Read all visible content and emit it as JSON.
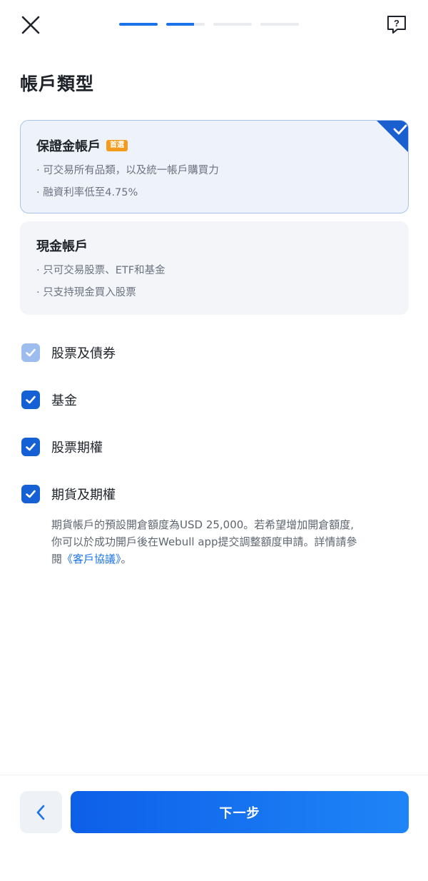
{
  "header": {
    "close_icon": "close-icon",
    "help_icon": "help-icon",
    "progress": {
      "total_steps": 4,
      "completed_steps": 2
    }
  },
  "page": {
    "title": "帳戶類型"
  },
  "accounts": {
    "margin": {
      "title": "保證金帳戶",
      "badge": "首選",
      "selected": true,
      "lines": [
        "· 可交易所有品類，以及統一帳戶購買力",
        "· 融資利率低至4.75%"
      ]
    },
    "cash": {
      "title": "現金帳戶",
      "selected": false,
      "lines": [
        "· 只可交易股票、ETF和基金",
        "· 只支持現金買入股票"
      ]
    }
  },
  "products": [
    {
      "label": "股票及債券",
      "checked": true,
      "disabled": true
    },
    {
      "label": "基金",
      "checked": true,
      "disabled": false
    },
    {
      "label": "股票期權",
      "checked": true,
      "disabled": false
    },
    {
      "label": "期貨及期權",
      "checked": true,
      "disabled": false
    }
  ],
  "futures_note": {
    "line1": "期貨帳戶的預設開倉額度為USD 25,000。若希望增加開倉額度,",
    "line2": "你可以於成功開戶後在Webull app提交調整額度申請。詳情請參",
    "line3_prefix": "閱",
    "link": "《客戶協議》",
    "line3_suffix": "。"
  },
  "footer": {
    "back_icon": "chevron-left-icon",
    "next_label": "下一步"
  },
  "colors": {
    "accent": "#1a73e8",
    "badge": "#f29b1d",
    "checkbox": "#1560d4",
    "checkbox_disabled": "#9dbdee"
  }
}
